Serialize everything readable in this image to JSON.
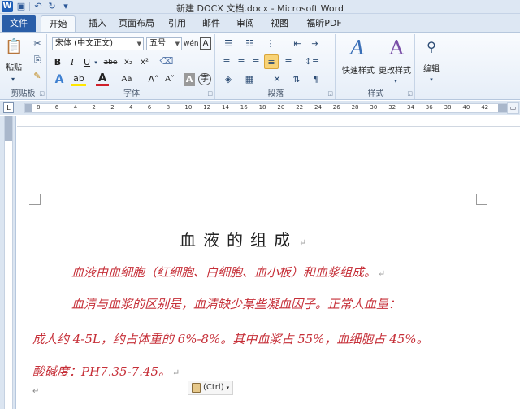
{
  "window": {
    "title": "新建 DOCX 文档.docx - Microsoft Word",
    "app_icon": "W",
    "quick_access": {
      "save_icon": "save-icon",
      "undo_icon": "undo-icon",
      "redo_icon": "redo-icon"
    }
  },
  "tabs": [
    {
      "label": "文件"
    },
    {
      "label": "开始"
    },
    {
      "label": "插入"
    },
    {
      "label": "页面布局"
    },
    {
      "label": "引用"
    },
    {
      "label": "邮件"
    },
    {
      "label": "审阅"
    },
    {
      "label": "视图"
    },
    {
      "label": "福昕PDF"
    }
  ],
  "ribbon": {
    "clipboard": {
      "label": "剪贴板",
      "paste_label": "粘贴"
    },
    "font": {
      "label": "字体",
      "font_name": "宋体 (中文正文)",
      "font_size": "五号",
      "bold": "B",
      "italic": "I",
      "underline": "U",
      "strike": "abe",
      "subscript": "x₂",
      "superscript": "x²",
      "font_color_glyph": "A",
      "change_case": "Aa",
      "grow": "A˄",
      "shrink": "A˅",
      "wen": "wén",
      "char_border": "A",
      "char_shading": "A",
      "enclose": "字"
    },
    "paragraph": {
      "label": "段落"
    },
    "styles": {
      "label": "样式",
      "quick_styles": "快速样式",
      "change_styles": "更改样式"
    },
    "editing": {
      "label": "编辑"
    }
  },
  "ruler": {
    "tab_selector": "L",
    "numbers": [
      "8",
      "6",
      "4",
      "2",
      "2",
      "4",
      "6",
      "8",
      "10",
      "12",
      "14",
      "16",
      "18",
      "20",
      "22",
      "24",
      "26",
      "28",
      "30",
      "32",
      "34",
      "36",
      "38",
      "40",
      "42"
    ]
  },
  "document": {
    "title": "血液的组成",
    "para_mark": "↵",
    "lines": [
      "血液由血细胞（红细胞、白细胞、血小板）和血浆组成。",
      "血清与血浆的区别是，血清缺少某些凝血因子。正常人血量：",
      "成人约 4-5L，约占体重的 6%-8%。其中血浆占 55%，血细胞占 45%。",
      "酸碱度：PH7.35-7.45。"
    ],
    "paste_options": "(Ctrl)"
  },
  "colors": {
    "accent": "#2a5ea8",
    "doc_text_red": "#c62f38",
    "ribbon_bg": "#dde7f3"
  }
}
